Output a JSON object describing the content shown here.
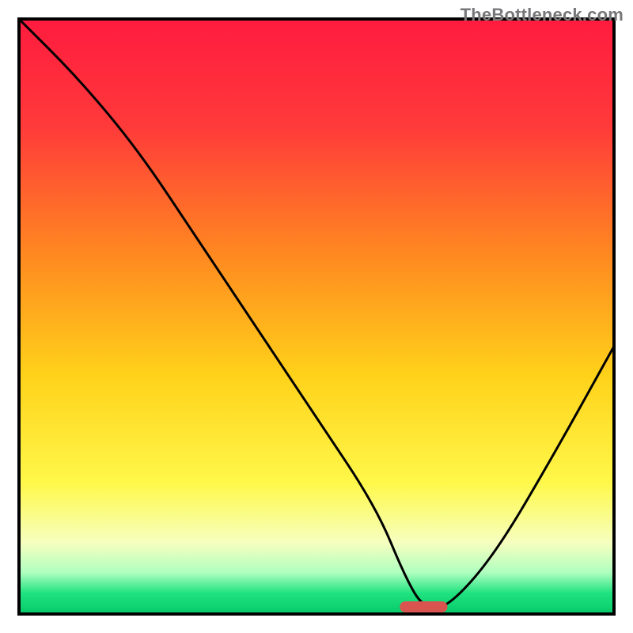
{
  "watermark": "TheBottleneck.com",
  "chart_data": {
    "type": "line",
    "title": "",
    "xlabel": "",
    "ylabel": "",
    "xlim": [
      0,
      100
    ],
    "ylim": [
      0,
      100
    ],
    "grid": false,
    "legend": false,
    "series": [
      {
        "name": "curve",
        "x": [
          0,
          10,
          20,
          30,
          40,
          50,
          60,
          65,
          68,
          72,
          80,
          90,
          100
        ],
        "y": [
          100,
          90,
          78,
          63,
          48,
          33,
          18,
          6,
          1,
          1,
          10,
          27,
          45
        ]
      }
    ],
    "marker": {
      "x": 68,
      "width": 8,
      "color": "#d9534f"
    },
    "gradient_stops": [
      {
        "offset": 0.0,
        "color": "#ff1b3f"
      },
      {
        "offset": 0.18,
        "color": "#ff3a3a"
      },
      {
        "offset": 0.4,
        "color": "#ff8a20"
      },
      {
        "offset": 0.6,
        "color": "#ffd21a"
      },
      {
        "offset": 0.78,
        "color": "#fff84a"
      },
      {
        "offset": 0.88,
        "color": "#f6ffbf"
      },
      {
        "offset": 0.93,
        "color": "#b0ffc0"
      },
      {
        "offset": 0.965,
        "color": "#20e27f"
      },
      {
        "offset": 1.0,
        "color": "#06c96a"
      }
    ],
    "frame": {
      "x0": 3,
      "y0": 3,
      "x1": 97,
      "y1": 97
    }
  }
}
